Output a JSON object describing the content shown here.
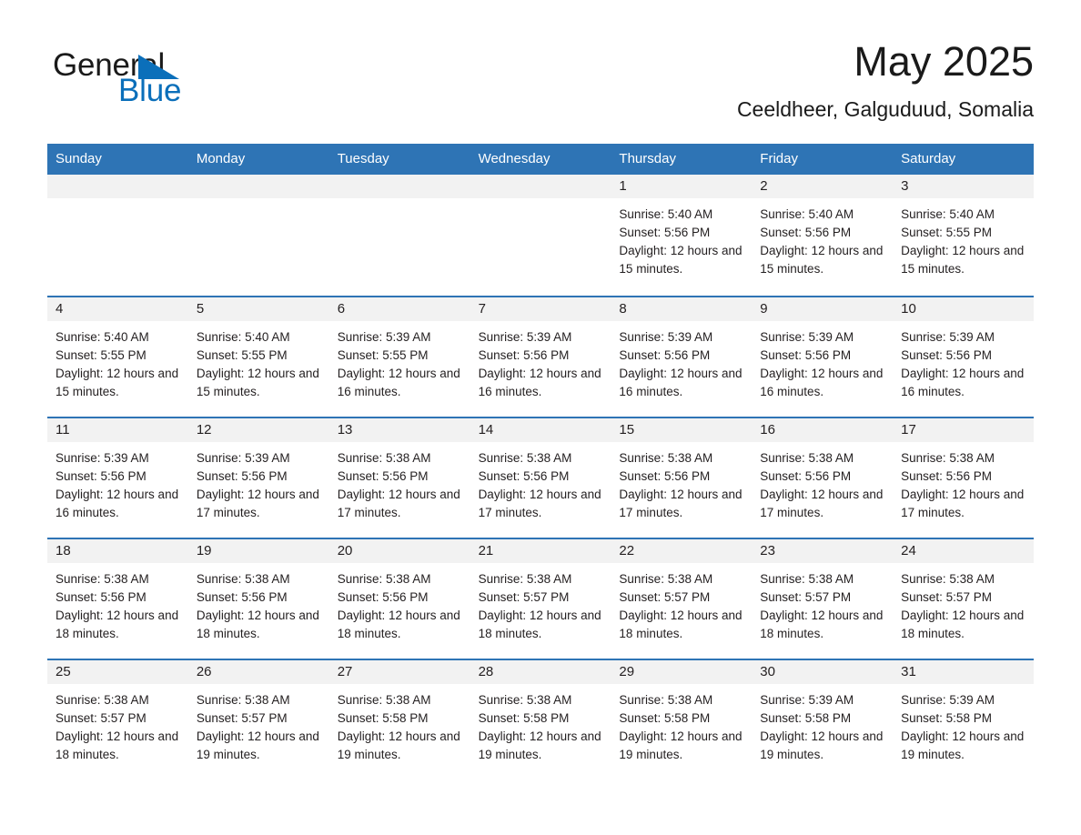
{
  "brand": {
    "name_part1": "General",
    "name_part2": "Blue",
    "flag_icon": "triangle-flag-icon",
    "accent_color": "#0b6fba"
  },
  "header": {
    "month_title": "May 2025",
    "location": "Ceeldheer, Galguduud, Somalia"
  },
  "theme": {
    "header_blue": "#2e74b5",
    "day_band_gray": "#f2f2f2",
    "text": "#231f20"
  },
  "calendar": {
    "weekdays": [
      "Sunday",
      "Monday",
      "Tuesday",
      "Wednesday",
      "Thursday",
      "Friday",
      "Saturday"
    ],
    "weeks": [
      [
        {
          "day": "",
          "sunrise": "",
          "sunset": "",
          "daylight": "",
          "empty": true
        },
        {
          "day": "",
          "sunrise": "",
          "sunset": "",
          "daylight": "",
          "empty": true
        },
        {
          "day": "",
          "sunrise": "",
          "sunset": "",
          "daylight": "",
          "empty": true
        },
        {
          "day": "",
          "sunrise": "",
          "sunset": "",
          "daylight": "",
          "empty": true
        },
        {
          "day": "1",
          "sunrise": "Sunrise: 5:40 AM",
          "sunset": "Sunset: 5:56 PM",
          "daylight": "Daylight: 12 hours and 15 minutes."
        },
        {
          "day": "2",
          "sunrise": "Sunrise: 5:40 AM",
          "sunset": "Sunset: 5:56 PM",
          "daylight": "Daylight: 12 hours and 15 minutes."
        },
        {
          "day": "3",
          "sunrise": "Sunrise: 5:40 AM",
          "sunset": "Sunset: 5:55 PM",
          "daylight": "Daylight: 12 hours and 15 minutes."
        }
      ],
      [
        {
          "day": "4",
          "sunrise": "Sunrise: 5:40 AM",
          "sunset": "Sunset: 5:55 PM",
          "daylight": "Daylight: 12 hours and 15 minutes."
        },
        {
          "day": "5",
          "sunrise": "Sunrise: 5:40 AM",
          "sunset": "Sunset: 5:55 PM",
          "daylight": "Daylight: 12 hours and 15 minutes."
        },
        {
          "day": "6",
          "sunrise": "Sunrise: 5:39 AM",
          "sunset": "Sunset: 5:55 PM",
          "daylight": "Daylight: 12 hours and 16 minutes."
        },
        {
          "day": "7",
          "sunrise": "Sunrise: 5:39 AM",
          "sunset": "Sunset: 5:56 PM",
          "daylight": "Daylight: 12 hours and 16 minutes."
        },
        {
          "day": "8",
          "sunrise": "Sunrise: 5:39 AM",
          "sunset": "Sunset: 5:56 PM",
          "daylight": "Daylight: 12 hours and 16 minutes."
        },
        {
          "day": "9",
          "sunrise": "Sunrise: 5:39 AM",
          "sunset": "Sunset: 5:56 PM",
          "daylight": "Daylight: 12 hours and 16 minutes."
        },
        {
          "day": "10",
          "sunrise": "Sunrise: 5:39 AM",
          "sunset": "Sunset: 5:56 PM",
          "daylight": "Daylight: 12 hours and 16 minutes."
        }
      ],
      [
        {
          "day": "11",
          "sunrise": "Sunrise: 5:39 AM",
          "sunset": "Sunset: 5:56 PM",
          "daylight": "Daylight: 12 hours and 16 minutes."
        },
        {
          "day": "12",
          "sunrise": "Sunrise: 5:39 AM",
          "sunset": "Sunset: 5:56 PM",
          "daylight": "Daylight: 12 hours and 17 minutes."
        },
        {
          "day": "13",
          "sunrise": "Sunrise: 5:38 AM",
          "sunset": "Sunset: 5:56 PM",
          "daylight": "Daylight: 12 hours and 17 minutes."
        },
        {
          "day": "14",
          "sunrise": "Sunrise: 5:38 AM",
          "sunset": "Sunset: 5:56 PM",
          "daylight": "Daylight: 12 hours and 17 minutes."
        },
        {
          "day": "15",
          "sunrise": "Sunrise: 5:38 AM",
          "sunset": "Sunset: 5:56 PM",
          "daylight": "Daylight: 12 hours and 17 minutes."
        },
        {
          "day": "16",
          "sunrise": "Sunrise: 5:38 AM",
          "sunset": "Sunset: 5:56 PM",
          "daylight": "Daylight: 12 hours and 17 minutes."
        },
        {
          "day": "17",
          "sunrise": "Sunrise: 5:38 AM",
          "sunset": "Sunset: 5:56 PM",
          "daylight": "Daylight: 12 hours and 17 minutes."
        }
      ],
      [
        {
          "day": "18",
          "sunrise": "Sunrise: 5:38 AM",
          "sunset": "Sunset: 5:56 PM",
          "daylight": "Daylight: 12 hours and 18 minutes."
        },
        {
          "day": "19",
          "sunrise": "Sunrise: 5:38 AM",
          "sunset": "Sunset: 5:56 PM",
          "daylight": "Daylight: 12 hours and 18 minutes."
        },
        {
          "day": "20",
          "sunrise": "Sunrise: 5:38 AM",
          "sunset": "Sunset: 5:56 PM",
          "daylight": "Daylight: 12 hours and 18 minutes."
        },
        {
          "day": "21",
          "sunrise": "Sunrise: 5:38 AM",
          "sunset": "Sunset: 5:57 PM",
          "daylight": "Daylight: 12 hours and 18 minutes."
        },
        {
          "day": "22",
          "sunrise": "Sunrise: 5:38 AM",
          "sunset": "Sunset: 5:57 PM",
          "daylight": "Daylight: 12 hours and 18 minutes."
        },
        {
          "day": "23",
          "sunrise": "Sunrise: 5:38 AM",
          "sunset": "Sunset: 5:57 PM",
          "daylight": "Daylight: 12 hours and 18 minutes."
        },
        {
          "day": "24",
          "sunrise": "Sunrise: 5:38 AM",
          "sunset": "Sunset: 5:57 PM",
          "daylight": "Daylight: 12 hours and 18 minutes."
        }
      ],
      [
        {
          "day": "25",
          "sunrise": "Sunrise: 5:38 AM",
          "sunset": "Sunset: 5:57 PM",
          "daylight": "Daylight: 12 hours and 18 minutes."
        },
        {
          "day": "26",
          "sunrise": "Sunrise: 5:38 AM",
          "sunset": "Sunset: 5:57 PM",
          "daylight": "Daylight: 12 hours and 19 minutes."
        },
        {
          "day": "27",
          "sunrise": "Sunrise: 5:38 AM",
          "sunset": "Sunset: 5:58 PM",
          "daylight": "Daylight: 12 hours and 19 minutes."
        },
        {
          "day": "28",
          "sunrise": "Sunrise: 5:38 AM",
          "sunset": "Sunset: 5:58 PM",
          "daylight": "Daylight: 12 hours and 19 minutes."
        },
        {
          "day": "29",
          "sunrise": "Sunrise: 5:38 AM",
          "sunset": "Sunset: 5:58 PM",
          "daylight": "Daylight: 12 hours and 19 minutes."
        },
        {
          "day": "30",
          "sunrise": "Sunrise: 5:39 AM",
          "sunset": "Sunset: 5:58 PM",
          "daylight": "Daylight: 12 hours and 19 minutes."
        },
        {
          "day": "31",
          "sunrise": "Sunrise: 5:39 AM",
          "sunset": "Sunset: 5:58 PM",
          "daylight": "Daylight: 12 hours and 19 minutes."
        }
      ]
    ]
  }
}
